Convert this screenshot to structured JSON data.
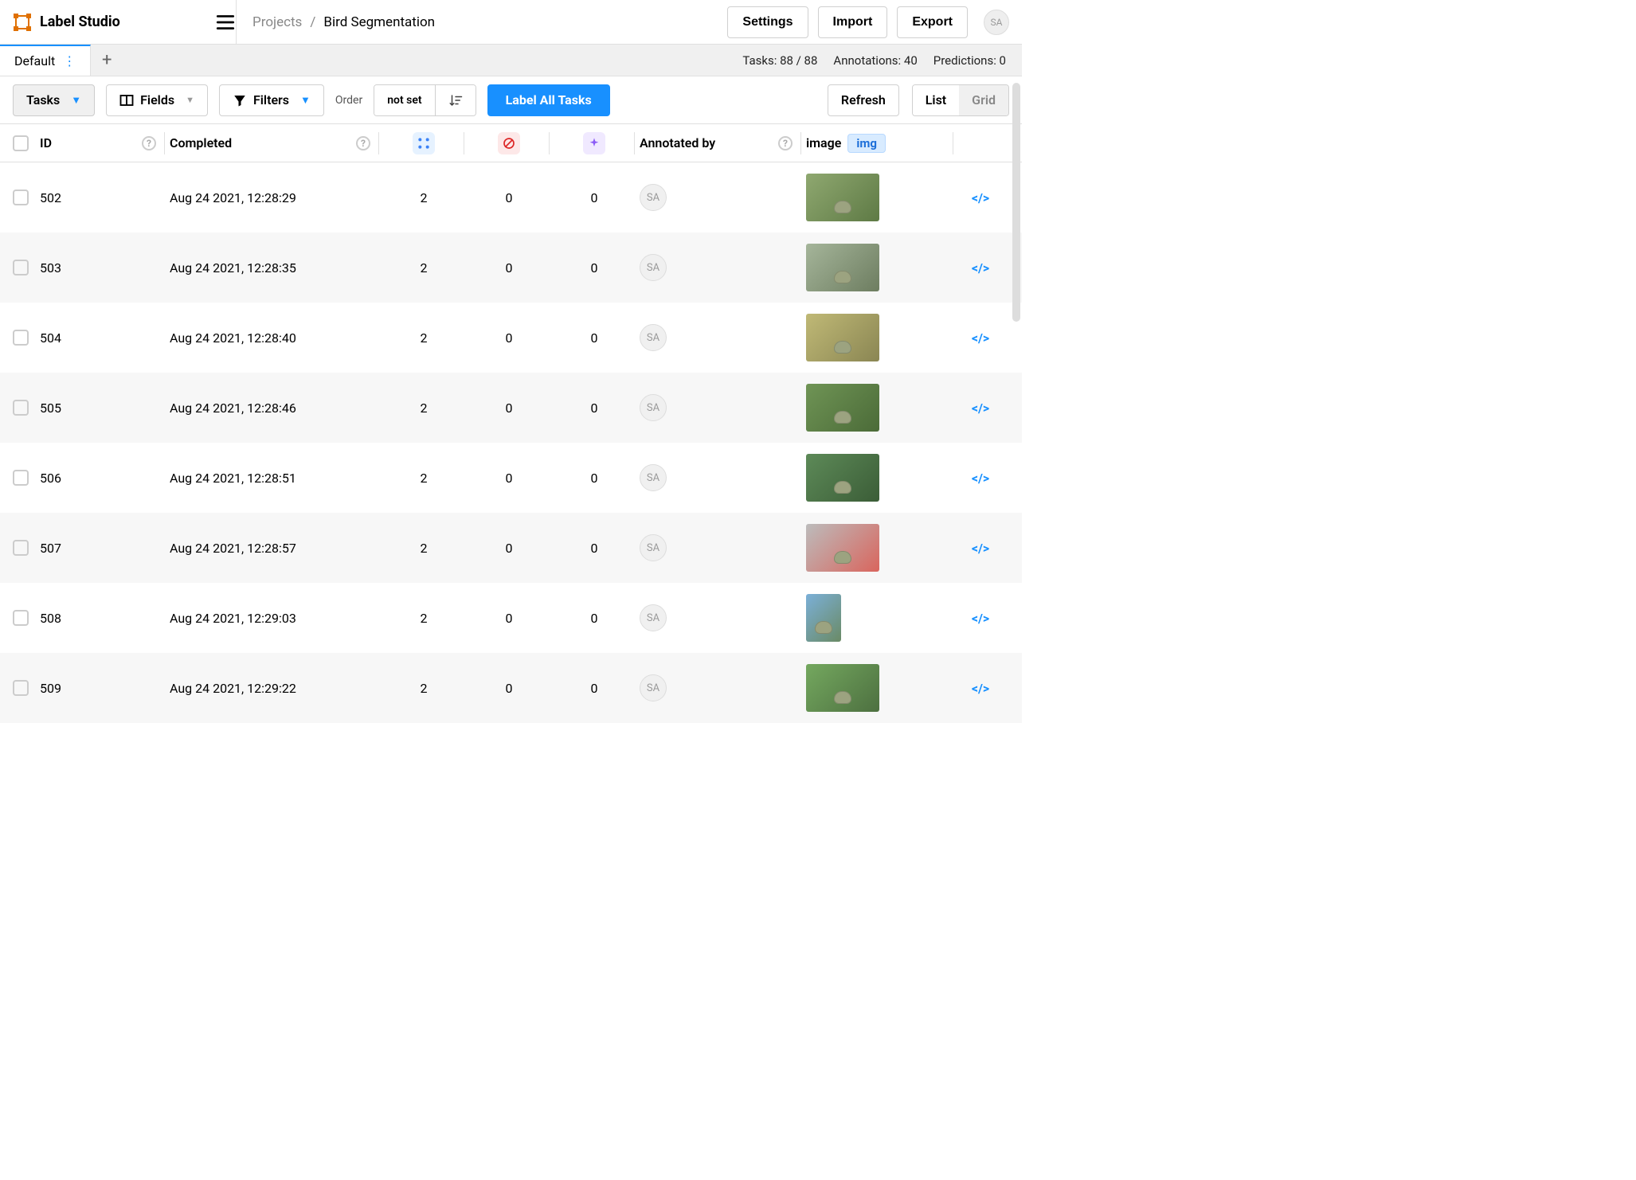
{
  "app": {
    "name": "Label Studio"
  },
  "breadcrumb": {
    "projects": "Projects",
    "slash": "/",
    "project_name": "Bird Segmentation"
  },
  "header_buttons": {
    "settings": "Settings",
    "import": "Import",
    "export": "Export"
  },
  "user": {
    "initials": "SA"
  },
  "tab": {
    "name": "Default"
  },
  "stats": {
    "tasks": "Tasks: 88 / 88",
    "annotations": "Annotations: 40",
    "predictions": "Predictions: 0"
  },
  "toolbar": {
    "tasks": "Tasks",
    "fields": "Fields",
    "filters": "Filters",
    "order_label": "Order",
    "order_value": "not set",
    "label_all": "Label All Tasks",
    "refresh": "Refresh",
    "list": "List",
    "grid": "Grid"
  },
  "columns": {
    "id": "ID",
    "completed": "Completed",
    "annotated_by": "Annotated by",
    "image": "image",
    "img": "img"
  },
  "rows": [
    {
      "id": "502",
      "completed": "Aug 24 2021, 12:28:29",
      "c1": "2",
      "c2": "0",
      "c3": "0",
      "annot": "SA"
    },
    {
      "id": "503",
      "completed": "Aug 24 2021, 12:28:35",
      "c1": "2",
      "c2": "0",
      "c3": "0",
      "annot": "SA"
    },
    {
      "id": "504",
      "completed": "Aug 24 2021, 12:28:40",
      "c1": "2",
      "c2": "0",
      "c3": "0",
      "annot": "SA"
    },
    {
      "id": "505",
      "completed": "Aug 24 2021, 12:28:46",
      "c1": "2",
      "c2": "0",
      "c3": "0",
      "annot": "SA"
    },
    {
      "id": "506",
      "completed": "Aug 24 2021, 12:28:51",
      "c1": "2",
      "c2": "0",
      "c3": "0",
      "annot": "SA"
    },
    {
      "id": "507",
      "completed": "Aug 24 2021, 12:28:57",
      "c1": "2",
      "c2": "0",
      "c3": "0",
      "annot": "SA"
    },
    {
      "id": "508",
      "completed": "Aug 24 2021, 12:29:03",
      "c1": "2",
      "c2": "0",
      "c3": "0",
      "annot": "SA"
    },
    {
      "id": "509",
      "completed": "Aug 24 2021, 12:29:22",
      "c1": "2",
      "c2": "0",
      "c3": "0",
      "annot": "SA"
    }
  ],
  "thumb_colors": [
    "linear-gradient(135deg,#8fa870,#5e7a45)",
    "linear-gradient(135deg,#a5b59a,#6d7d60)",
    "linear-gradient(135deg,#c0b976,#8a8653)",
    "linear-gradient(135deg,#6f9455,#4b6b38)",
    "linear-gradient(135deg,#5d8a58,#3b5d37)",
    "linear-gradient(135deg,#bcbcbc,#d9655d)",
    "linear-gradient(135deg,#7bb0d8,#6a8a65)",
    "linear-gradient(135deg,#74a85f,#4d7040)"
  ]
}
